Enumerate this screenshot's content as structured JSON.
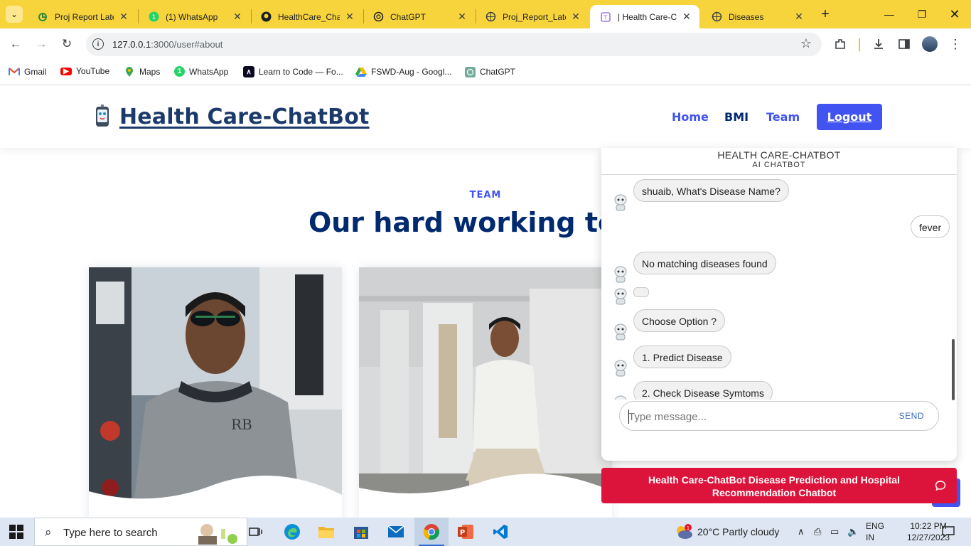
{
  "browser": {
    "tabs": [
      {
        "title": "Proj Report Late",
        "icon": "project-icon"
      },
      {
        "title": "(1) WhatsApp",
        "icon": "whatsapp-icon"
      },
      {
        "title": "HealthCare_Chat",
        "icon": "github-icon"
      },
      {
        "title": "ChatGPT",
        "icon": "chatgpt-icon"
      },
      {
        "title": "Proj_Report_Late",
        "icon": "project-icon"
      },
      {
        "title": "| Health Care-Ch",
        "icon": "page-icon"
      },
      {
        "title": "Diseases",
        "icon": "globe-icon"
      }
    ],
    "url_host": "127.0.0.1",
    "url_path": ":3000/user#about",
    "bookmarks": [
      {
        "label": "Gmail",
        "icon": "gmail-icon"
      },
      {
        "label": "YouTube",
        "icon": "youtube-icon"
      },
      {
        "label": "Maps",
        "icon": "maps-icon"
      },
      {
        "label": "WhatsApp",
        "icon": "whatsapp-icon"
      },
      {
        "label": "Learn to Code — Fo...",
        "icon": "freecodecamp-icon"
      },
      {
        "label": "FSWD-Aug - Googl...",
        "icon": "drive-icon"
      },
      {
        "label": "ChatGPT",
        "icon": "chatgpt-icon"
      }
    ]
  },
  "site": {
    "brand": "Health Care-ChatBot",
    "nav": {
      "home": "Home",
      "bmi": "BMI",
      "team": "Team",
      "logout": "Logout"
    },
    "section_tag": "TEAM",
    "section_title": "Our hard working team",
    "accent": "#4154f1",
    "title_color": "#012970"
  },
  "chat": {
    "title": "HEALTH CARE-CHATBOT",
    "subtitle": "AI CHATBOT",
    "messages": [
      {
        "from": "bot",
        "text": "shuaib, What's Disease Name?"
      },
      {
        "from": "user",
        "text": "fever"
      },
      {
        "from": "bot",
        "text": "No matching diseases found"
      },
      {
        "from": "bot",
        "text": ""
      },
      {
        "from": "bot",
        "text": "Choose Option ?"
      },
      {
        "from": "bot",
        "text": "1. Predict Disease"
      },
      {
        "from": "bot",
        "text": "2. Check Disease Symtoms"
      }
    ],
    "input_placeholder": "Type message...",
    "send_label": "SEND",
    "bar_text": "Health Care-ChatBot Disease Prediction and Hospital Recommendation Chatbot",
    "bar_color": "#dc143c"
  },
  "taskbar": {
    "search_placeholder": "Type here to search",
    "weather": "20°C  Partly cloudy",
    "lang_line1": "ENG",
    "lang_line2": "IN",
    "time": "10:22 PM",
    "date": "12/27/2023",
    "weather_badge": "1"
  }
}
